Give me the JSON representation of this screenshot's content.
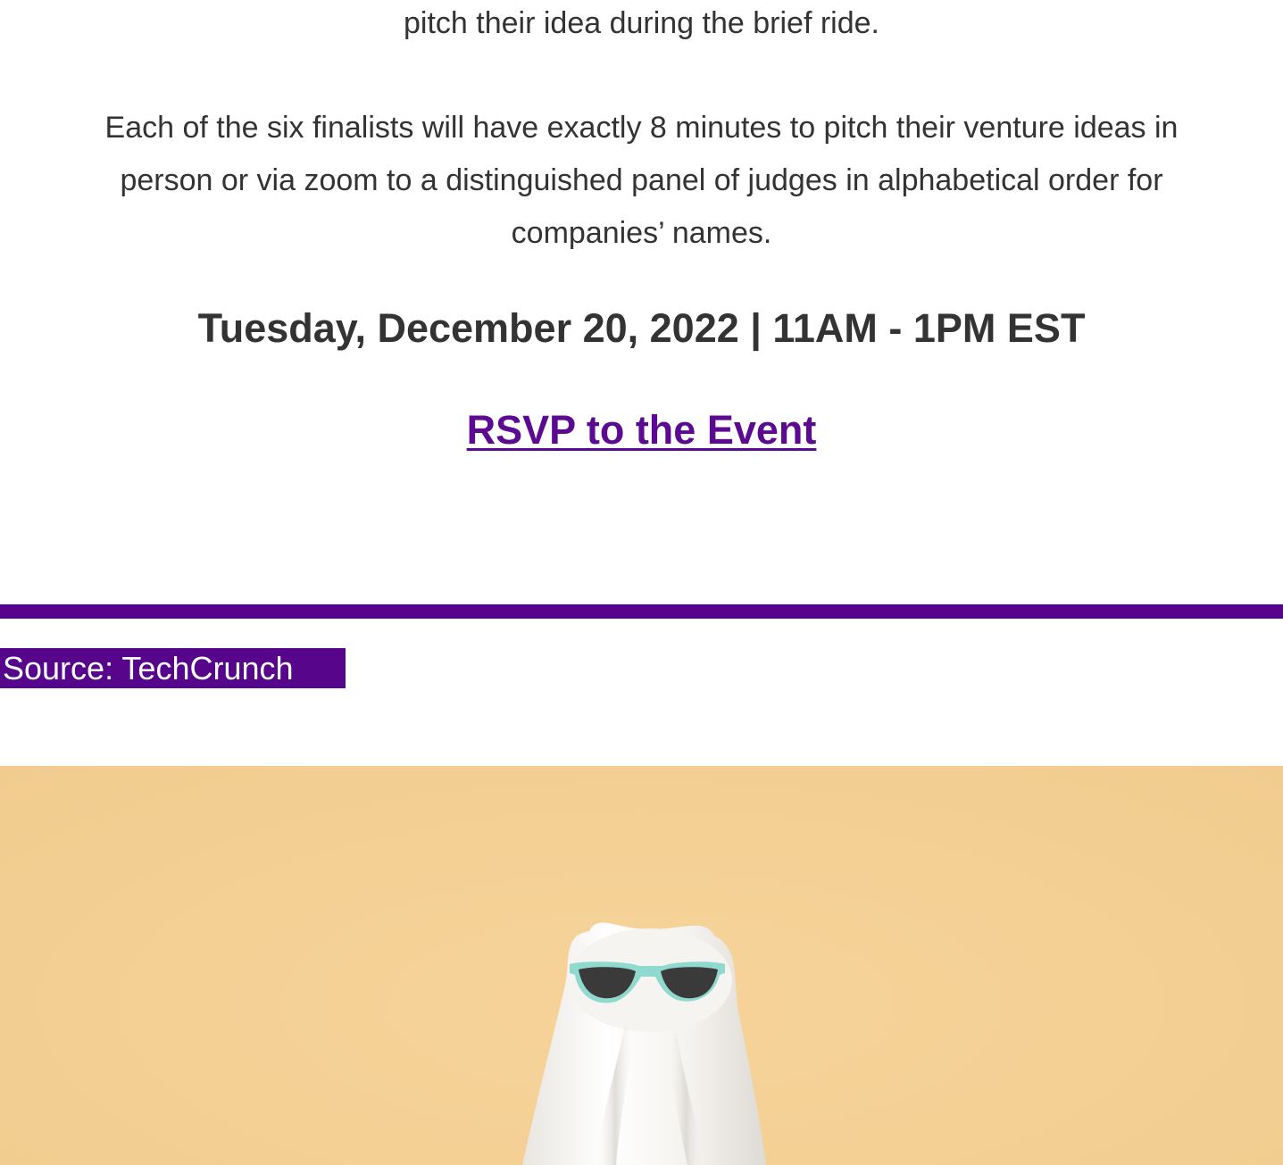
{
  "content": {
    "paragraph_top": "pitch their idea during the brief ride.",
    "paragraph_main_line1": "Each of the six finalists will have exactly 8 minutes to pitch their venture ideas in",
    "paragraph_main_line2": "person or via zoom to a distinguished panel of judges in alphabetical order for",
    "paragraph_main_line3": "companies’ names.",
    "event_date": "Tuesday, December 20, 2022 | 11AM - 1PM EST",
    "rsvp_label": "RSVP to the Event",
    "source_label": "Source: TechCrunch"
  },
  "image": {
    "subject": "ghost-wearing-sunglasses",
    "icon": "ghost-icon"
  },
  "colors": {
    "accent": "#57068c",
    "link": "#5b0a91",
    "text": "#333333",
    "photo_background": "#f4d095",
    "sunglasses_frame": "#8fd9cf",
    "sunglasses_lens": "#3a3a3a"
  }
}
